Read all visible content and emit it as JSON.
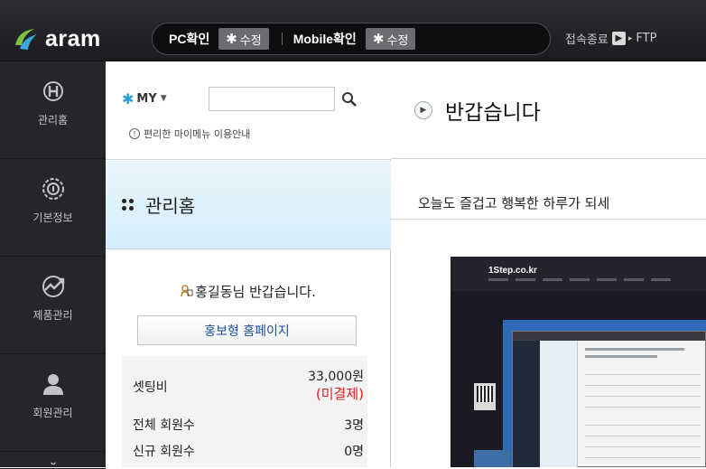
{
  "header": {
    "logo_text": "aram",
    "pc_check_label": "PC확인",
    "pc_edit_label": "수정",
    "mobile_check_label": "Mobile확인",
    "mobile_edit_label": "수정",
    "logout_label": "접속종료",
    "ftp_label": "FTP"
  },
  "sidebar": {
    "items": [
      {
        "label": "관리홈",
        "icon": "home-h-icon"
      },
      {
        "label": "기본정보",
        "icon": "info-gear-icon"
      },
      {
        "label": "제품관리",
        "icon": "product-chart-icon"
      },
      {
        "label": "회원관리",
        "icon": "member-icon"
      },
      {
        "label": "",
        "icon": "sprout-icon"
      }
    ]
  },
  "my_menu": {
    "button_label": "MY",
    "search_placeholder": "",
    "guide_text": "편리한 마이메뉴 이용안내"
  },
  "home_panel": {
    "title": "관리홈",
    "greeting": "홍길동님 반갑습니다.",
    "promo_button": "홍보형 홈페이지",
    "stats": [
      {
        "label": "셋팅비",
        "value": "33,000원",
        "note": "(미결제)"
      },
      {
        "label": "전체 회원수",
        "value": "3명"
      },
      {
        "label": "신규 회원수",
        "value": "0명"
      }
    ]
  },
  "main": {
    "title": "반갑습니다",
    "welcome_message": "오늘도 즐겁고 행복한 하루가 되세",
    "preview_brand": "1Step.co.kr"
  },
  "colors": {
    "topbar": "#1b1c1f",
    "sidebar": "#25262a",
    "accent_blue": "#d4edfb",
    "unpaid_red": "#e02020",
    "link_blue": "#1a4f9c"
  }
}
